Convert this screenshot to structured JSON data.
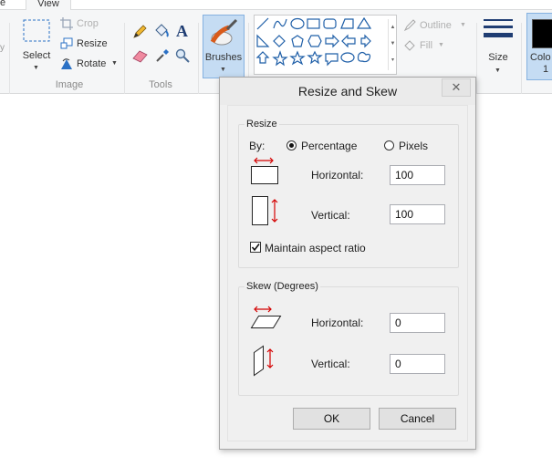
{
  "ribbon": {
    "tabs": {
      "partial": "e",
      "view": "View"
    },
    "image_group": {
      "label": "Image",
      "select": "Select",
      "crop": "Crop",
      "resize": "Resize",
      "rotate": "Rotate"
    },
    "tools_group": {
      "label": "Tools"
    },
    "brushes": "Brushes",
    "outline": "Outline",
    "fill": "Fill",
    "size": "Size",
    "color1": "Colo",
    "color1_num": "1"
  },
  "dialog": {
    "title": "Resize and Skew",
    "close_glyph": "✕",
    "resize": {
      "legend": "Resize",
      "by_label": "By:",
      "percentage": "Percentage",
      "pixels": "Pixels",
      "selected_mode": "Percentage",
      "horizontal_label": "Horizontal:",
      "horizontal_value": "100",
      "vertical_label": "Vertical:",
      "vertical_value": "100",
      "maintain_label": "Maintain aspect ratio",
      "maintain_checked": true
    },
    "skew": {
      "legend": "Skew (Degrees)",
      "horizontal_label": "Horizontal:",
      "horizontal_value": "0",
      "vertical_label": "Vertical:",
      "vertical_value": "0"
    },
    "ok": "OK",
    "cancel": "Cancel"
  },
  "colors": {
    "arrow_red": "#d40000",
    "shape_blue": "#1f5fa8",
    "ribbon_bg": "#f5f6f7",
    "brushes_highlight": "#c5dcf3"
  }
}
